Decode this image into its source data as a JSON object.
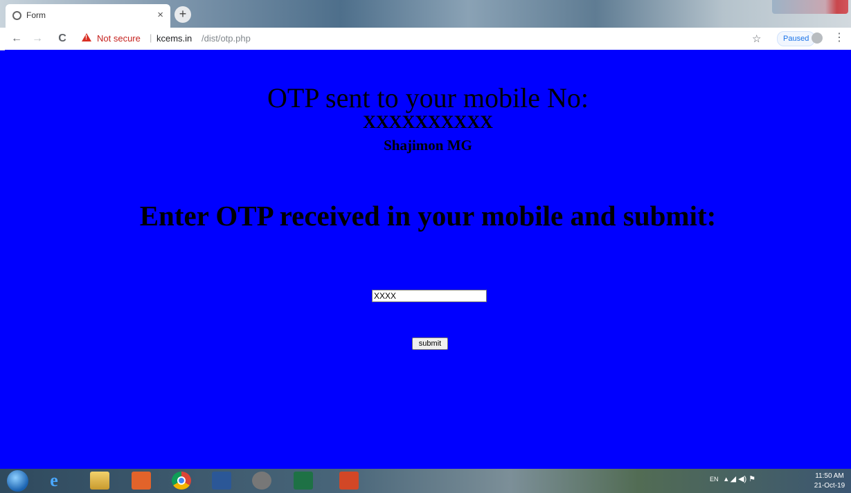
{
  "browser": {
    "tab_title": "Form",
    "tab_close": "×",
    "new_tab": "+",
    "security_label": "Not secure",
    "url_separator": "|",
    "url_host": "kcems.in",
    "url_path": "/dist/otp.php",
    "profile_status": "Paused",
    "menu_glyph": "⋮",
    "back_glyph": "←",
    "forward_glyph": "→",
    "reload_glyph": "C",
    "star_glyph": "☆"
  },
  "page": {
    "background_color": "#0000ff",
    "otp_heading": "OTP sent to your mobile No:",
    "mobile_number": "XXXXXXXXXX",
    "user_name": "Shajimon MG",
    "enter_otp_heading": "Enter OTP received in your mobile and submit:",
    "otp_input_value": "XXXX",
    "submit_label": "submit"
  },
  "taskbar": {
    "ie_glyph": "e",
    "language": "EN",
    "tray_glyphs": "▴  ◢  ◀)  ⚑",
    "clock_time": "11:50 AM",
    "clock_date": "21-Oct-19"
  }
}
